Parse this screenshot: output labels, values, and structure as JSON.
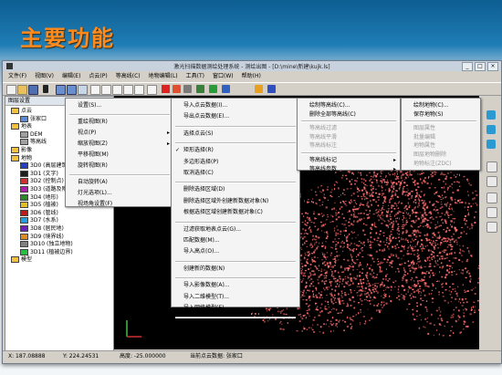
{
  "slide": {
    "title": "主要功能"
  },
  "window": {
    "title": "激光扫描数据测绘处理系统 - 测绘出图 - [D:\\mine\\新建\\kujk.ls]",
    "minimize": "_",
    "maximize": "□",
    "close": "×"
  },
  "menubar": [
    "文件(F)",
    "视图(V)",
    "编辑(E)",
    "点云(P)",
    "等高线(C)",
    "地物编辑(L)",
    "工具(T)",
    "窗口(W)",
    "帮助(H)"
  ],
  "layer_panel": {
    "header": "图层设置",
    "items": [
      {
        "label": "点云",
        "indent": 0,
        "icon": "cloud-icon",
        "color": "#f3c13a"
      },
      {
        "label": "张家口",
        "indent": 1,
        "icon": "layer-icon",
        "color": "#5b8bd5"
      },
      {
        "label": "地表",
        "indent": 0,
        "icon": "ground-icon",
        "color": "#f3c13a"
      },
      {
        "label": "DEM",
        "indent": 1,
        "icon": "layer-icon",
        "color": "#a0a0a0"
      },
      {
        "label": "等高线",
        "indent": 1,
        "icon": "layer-icon",
        "color": "#a0a0a0"
      },
      {
        "label": "影像",
        "indent": 0,
        "icon": "image-icon",
        "color": "#f3c13a"
      },
      {
        "label": "地物",
        "indent": 0,
        "icon": "feature-icon",
        "color": "#f3c13a"
      },
      {
        "label": "3D0 (高层建筑)",
        "indent": 1,
        "icon": "swatch",
        "color": "#2440c8"
      },
      {
        "label": "3D1 (文字)",
        "indent": 1,
        "icon": "swatch",
        "color": "#1e1e1e"
      },
      {
        "label": "3D2 (控制点)",
        "indent": 1,
        "icon": "swatch",
        "color": "#d42d2d"
      },
      {
        "label": "3D3 (道路及附属)",
        "indent": 1,
        "icon": "swatch",
        "color": "#b01cb0"
      },
      {
        "label": "3D4 (地形)",
        "indent": 1,
        "icon": "swatch",
        "color": "#2a8a2a"
      },
      {
        "label": "3D5 (植被)",
        "indent": 1,
        "icon": "swatch",
        "color": "#e0c020"
      },
      {
        "label": "3D6 (管线)",
        "indent": 1,
        "icon": "swatch",
        "color": "#c01818"
      },
      {
        "label": "3D7 (水系)",
        "indent": 1,
        "icon": "swatch",
        "color": "#20a0e0"
      },
      {
        "label": "3D8 (居民地)",
        "indent": 1,
        "icon": "swatch",
        "color": "#7020c0"
      },
      {
        "label": "3D9 (境界线)",
        "indent": 1,
        "icon": "swatch",
        "color": "#e08a20"
      },
      {
        "label": "3D10 (独立地物)",
        "indent": 1,
        "icon": "swatch",
        "color": "#808080"
      },
      {
        "label": "3D11 (植被边界)",
        "indent": 1,
        "icon": "swatch",
        "color": "#20c040"
      },
      {
        "label": "模型",
        "indent": 0,
        "icon": "model-icon",
        "color": "#f3c13a"
      }
    ]
  },
  "context_menu_1": {
    "items": [
      {
        "label": "设置(S)...",
        "arrow": false
      },
      {
        "label": "重绘视图(R)",
        "arrow": false
      },
      {
        "label": "视点(P)",
        "arrow": true
      },
      {
        "label": "缩放视图(Z)",
        "arrow": true
      },
      {
        "label": "平移视图(M)",
        "arrow": false
      },
      {
        "label": "旋转视图(R)",
        "arrow": false
      },
      {
        "label": "自动旋转(A)",
        "arrow": false
      },
      {
        "label": "灯光选项(L)...",
        "arrow": false
      },
      {
        "label": "视场角设置(F)",
        "arrow": false
      }
    ]
  },
  "context_menu_2": {
    "items": [
      {
        "label": "导入点云数据(I)...",
        "checked": false
      },
      {
        "label": "导出点云数据(E)...",
        "checked": false
      },
      {
        "label": "选择点云(S)",
        "checked": false
      },
      {
        "label": "矩形选择(R)",
        "checked": true
      },
      {
        "label": "多边形选择(P)",
        "checked": false
      },
      {
        "label": "取消选择(C)",
        "checked": false
      },
      {
        "label": "删除选择区域(D)",
        "checked": false
      },
      {
        "label": "删除选择区域外创建新数据对象(N)",
        "checked": false
      },
      {
        "label": "根据选择区域创建新数据对象(C)",
        "checked": false
      },
      {
        "label": "过滤获取地表点云(G)...",
        "checked": false
      },
      {
        "label": "匹配数据(M)...",
        "checked": false
      },
      {
        "label": "导入高点(O)...",
        "checked": false
      },
      {
        "label": "创建新的数据(N)",
        "checked": false
      },
      {
        "label": "导入影像数据(A)...",
        "checked": false
      },
      {
        "label": "导入二维模型(T)...",
        "checked": false
      },
      {
        "label": "导入网络模型(E)...",
        "checked": false
      },
      {
        "label": "构建DEM(B)...",
        "checked": false
      }
    ]
  },
  "context_menu_3": {
    "items": [
      {
        "label": "绘制等高线(C)...",
        "disabled": false,
        "arrow": false
      },
      {
        "label": "删除全部等高线(C)",
        "disabled": false,
        "arrow": false
      },
      {
        "label": "等高线过滤",
        "disabled": true,
        "arrow": false
      },
      {
        "label": "等高线平滑",
        "disabled": true,
        "arrow": false
      },
      {
        "label": "等高线标注",
        "disabled": true,
        "arrow": false
      },
      {
        "label": "等高线标记",
        "disabled": false,
        "arrow": true
      },
      {
        "label": "等高线参数",
        "disabled": false,
        "arrow": true
      }
    ]
  },
  "context_menu_4": {
    "items": [
      {
        "label": "绘制地物(C)...",
        "disabled": false
      },
      {
        "label": "保存地物(S)",
        "disabled": false
      },
      {
        "label": "图层属性",
        "disabled": true
      },
      {
        "label": "批量编辑",
        "disabled": true
      },
      {
        "label": "地物属性",
        "disabled": true
      },
      {
        "label": "图层地物删除",
        "disabled": true
      },
      {
        "label": "地物标注(ZDC)",
        "disabled": true
      }
    ]
  },
  "statusbar": {
    "x_label": "X: 187.08888",
    "y_label": "Y: 224.24531",
    "z_label": "高度: -25.000000",
    "current": "当前点云数据: 张家口"
  },
  "colors": {
    "point_cloud": "#ff6f6f",
    "slide_title": "#ff8a1e"
  }
}
